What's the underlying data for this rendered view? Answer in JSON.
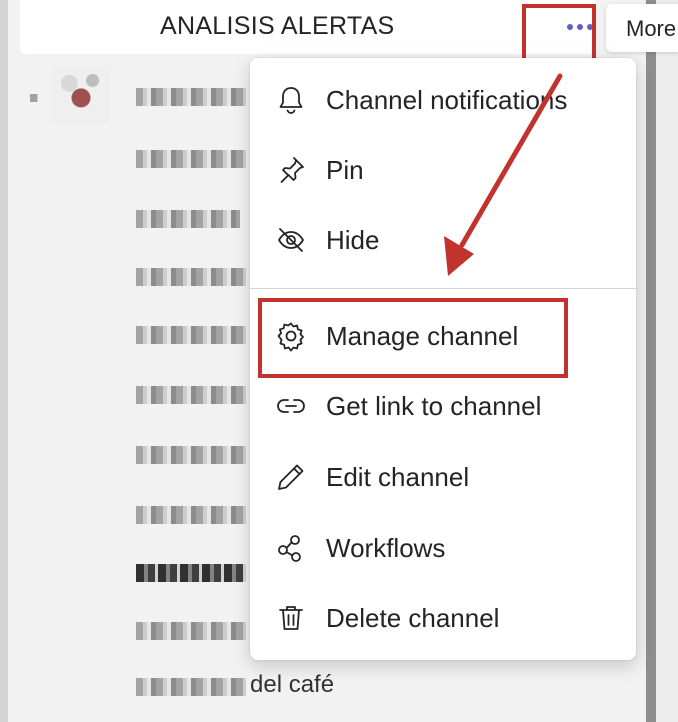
{
  "header": {
    "channel_title": "ANALISIS ALERTAS",
    "more_tooltip": "More"
  },
  "background": {
    "partial_text": "del café"
  },
  "menu": {
    "items": [
      {
        "label": "Channel notifications",
        "icon": "bell-icon"
      },
      {
        "label": "Pin",
        "icon": "pin-icon"
      },
      {
        "label": "Hide",
        "icon": "eye-off-icon"
      },
      {
        "label": "Manage channel",
        "icon": "gear-icon"
      },
      {
        "label": "Get link to channel",
        "icon": "link-icon"
      },
      {
        "label": "Edit channel",
        "icon": "pencil-icon"
      },
      {
        "label": "Workflows",
        "icon": "workflows-icon"
      },
      {
        "label": "Delete channel",
        "icon": "trash-icon"
      }
    ]
  },
  "colors": {
    "accent": "#5b5fc7",
    "annotation_red": "#c2332d",
    "text": "#242424",
    "menu_background": "#ffffff"
  }
}
